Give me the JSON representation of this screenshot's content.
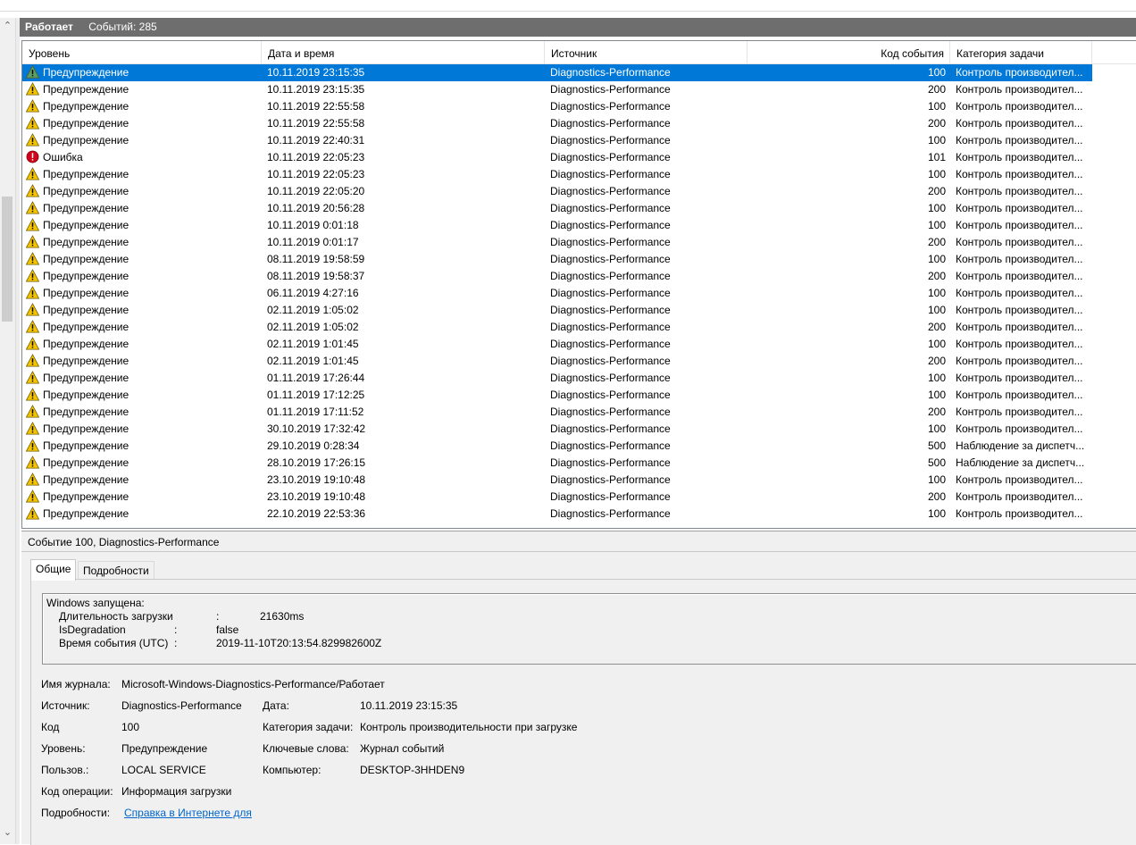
{
  "log": {
    "status": "Работает",
    "events_count": "Событий: 285"
  },
  "grid": {
    "columns": [
      "Уровень",
      "Дата и время",
      "Источник",
      "Код события",
      "Категория задачи"
    ],
    "rows": [
      {
        "level": "Предупреждение",
        "date": "10.11.2019 23:15:35",
        "source": "Diagnostics-Performance",
        "code": "100",
        "category": "Контроль производител...",
        "icon": "warning-icon",
        "selected": true
      },
      {
        "level": "Предупреждение",
        "date": "10.11.2019 23:15:35",
        "source": "Diagnostics-Performance",
        "code": "200",
        "category": "Контроль производител...",
        "icon": "warning-icon"
      },
      {
        "level": "Предупреждение",
        "date": "10.11.2019 22:55:58",
        "source": "Diagnostics-Performance",
        "code": "100",
        "category": "Контроль производител...",
        "icon": "warning-icon"
      },
      {
        "level": "Предупреждение",
        "date": "10.11.2019 22:55:58",
        "source": "Diagnostics-Performance",
        "code": "200",
        "category": "Контроль производител...",
        "icon": "warning-icon"
      },
      {
        "level": "Предупреждение",
        "date": "10.11.2019 22:40:31",
        "source": "Diagnostics-Performance",
        "code": "100",
        "category": "Контроль производител...",
        "icon": "warning-icon"
      },
      {
        "level": "Ошибка",
        "date": "10.11.2019 22:05:23",
        "source": "Diagnostics-Performance",
        "code": "101",
        "category": "Контроль производител...",
        "icon": "error-icon"
      },
      {
        "level": "Предупреждение",
        "date": "10.11.2019 22:05:23",
        "source": "Diagnostics-Performance",
        "code": "100",
        "category": "Контроль производител...",
        "icon": "warning-icon"
      },
      {
        "level": "Предупреждение",
        "date": "10.11.2019 22:05:20",
        "source": "Diagnostics-Performance",
        "code": "200",
        "category": "Контроль производител...",
        "icon": "warning-icon"
      },
      {
        "level": "Предупреждение",
        "date": "10.11.2019 20:56:28",
        "source": "Diagnostics-Performance",
        "code": "100",
        "category": "Контроль производител...",
        "icon": "warning-icon"
      },
      {
        "level": "Предупреждение",
        "date": "10.11.2019 0:01:18",
        "source": "Diagnostics-Performance",
        "code": "100",
        "category": "Контроль производител...",
        "icon": "warning-icon"
      },
      {
        "level": "Предупреждение",
        "date": "10.11.2019 0:01:17",
        "source": "Diagnostics-Performance",
        "code": "200",
        "category": "Контроль производител...",
        "icon": "warning-icon"
      },
      {
        "level": "Предупреждение",
        "date": "08.11.2019 19:58:59",
        "source": "Diagnostics-Performance",
        "code": "100",
        "category": "Контроль производител...",
        "icon": "warning-icon"
      },
      {
        "level": "Предупреждение",
        "date": "08.11.2019 19:58:37",
        "source": "Diagnostics-Performance",
        "code": "200",
        "category": "Контроль производител...",
        "icon": "warning-icon"
      },
      {
        "level": "Предупреждение",
        "date": "06.11.2019 4:27:16",
        "source": "Diagnostics-Performance",
        "code": "100",
        "category": "Контроль производител...",
        "icon": "warning-icon"
      },
      {
        "level": "Предупреждение",
        "date": "02.11.2019 1:05:02",
        "source": "Diagnostics-Performance",
        "code": "100",
        "category": "Контроль производител...",
        "icon": "warning-icon"
      },
      {
        "level": "Предупреждение",
        "date": "02.11.2019 1:05:02",
        "source": "Diagnostics-Performance",
        "code": "200",
        "category": "Контроль производител...",
        "icon": "warning-icon"
      },
      {
        "level": "Предупреждение",
        "date": "02.11.2019 1:01:45",
        "source": "Diagnostics-Performance",
        "code": "100",
        "category": "Контроль производител...",
        "icon": "warning-icon"
      },
      {
        "level": "Предупреждение",
        "date": "02.11.2019 1:01:45",
        "source": "Diagnostics-Performance",
        "code": "200",
        "category": "Контроль производител...",
        "icon": "warning-icon"
      },
      {
        "level": "Предупреждение",
        "date": "01.11.2019 17:26:44",
        "source": "Diagnostics-Performance",
        "code": "100",
        "category": "Контроль производител...",
        "icon": "warning-icon"
      },
      {
        "level": "Предупреждение",
        "date": "01.11.2019 17:12:25",
        "source": "Diagnostics-Performance",
        "code": "100",
        "category": "Контроль производител...",
        "icon": "warning-icon"
      },
      {
        "level": "Предупреждение",
        "date": "01.11.2019 17:11:52",
        "source": "Diagnostics-Performance",
        "code": "200",
        "category": "Контроль производител...",
        "icon": "warning-icon"
      },
      {
        "level": "Предупреждение",
        "date": "30.10.2019 17:32:42",
        "source": "Diagnostics-Performance",
        "code": "100",
        "category": "Контроль производител...",
        "icon": "warning-icon"
      },
      {
        "level": "Предупреждение",
        "date": "29.10.2019 0:28:34",
        "source": "Diagnostics-Performance",
        "code": "500",
        "category": "Наблюдение за диспетч...",
        "icon": "warning-icon"
      },
      {
        "level": "Предупреждение",
        "date": "28.10.2019 17:26:15",
        "source": "Diagnostics-Performance",
        "code": "500",
        "category": "Наблюдение за диспетч...",
        "icon": "warning-icon"
      },
      {
        "level": "Предупреждение",
        "date": "23.10.2019 19:10:48",
        "source": "Diagnostics-Performance",
        "code": "100",
        "category": "Контроль производител...",
        "icon": "warning-icon"
      },
      {
        "level": "Предупреждение",
        "date": "23.10.2019 19:10:48",
        "source": "Diagnostics-Performance",
        "code": "200",
        "category": "Контроль производител...",
        "icon": "warning-icon"
      },
      {
        "level": "Предупреждение",
        "date": "22.10.2019 22:53:36",
        "source": "Diagnostics-Performance",
        "code": "100",
        "category": "Контроль производител...",
        "icon": "warning-icon"
      }
    ]
  },
  "details": {
    "title": "Событие 100, Diagnostics-Performance",
    "tabs": [
      "Общие",
      "Подробности"
    ],
    "description": {
      "header": "Windows запущена:",
      "lines": [
        {
          "label": "Длительность загрузки",
          "sep": ":",
          "value": "21630ms"
        },
        {
          "label": "IsDegradation",
          "sep": ":",
          "value": "false"
        },
        {
          "label": "Время события (UTC)",
          "sep": ":",
          "value": "2019-11-10T20:13:54.829982600Z"
        }
      ]
    },
    "fields": {
      "log_name_label": "Имя журнала:",
      "log_name_value": "Microsoft-Windows-Diagnostics-Performance/Работает",
      "source_label": "Источник:",
      "source_value": "Diagnostics-Performance",
      "date_label": "Дата:",
      "date_value": "10.11.2019 23:15:35",
      "code_label": "Код",
      "code_value": "100",
      "category_label": "Категория задачи:",
      "category_value": "Контроль производительности при загрузке",
      "level_label": "Уровень:",
      "level_value": "Предупреждение",
      "keywords_label": "Ключевые слова:",
      "keywords_value": "Журнал событий",
      "user_label": "Пользов.:",
      "user_value": "LOCAL SERVICE",
      "computer_label": "Компьютер:",
      "computer_value": "DESKTOP-3HHDEN9",
      "opcode_label": "Код операции:",
      "opcode_value": "Информация загрузки",
      "more_label": "Подробности:",
      "more_link": "Справка в Интернете для"
    }
  },
  "colors": {
    "selection": "#0078d7",
    "header_bar": "#6e6e6e",
    "warning": "#f5c400",
    "error": "#d0021b"
  }
}
